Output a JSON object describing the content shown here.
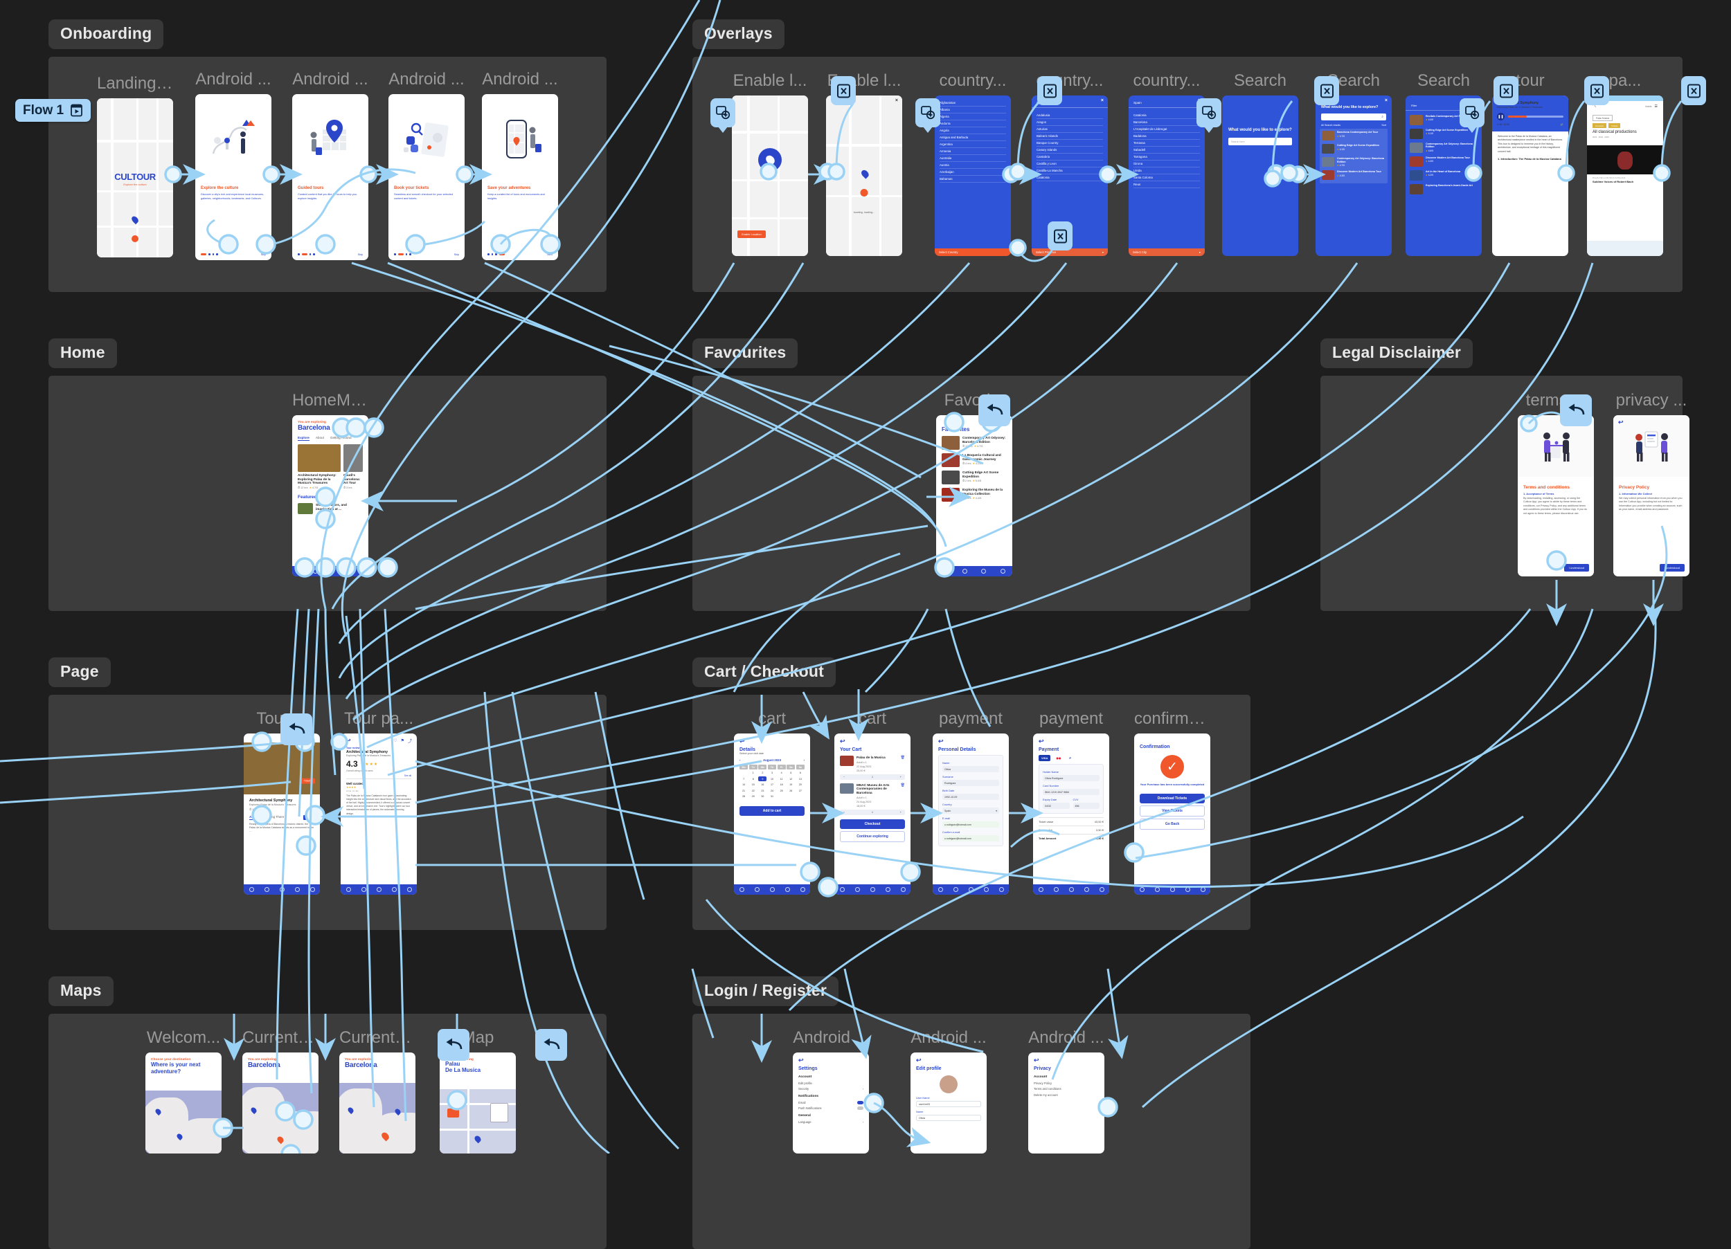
{
  "app": {
    "flow_badge_label": "Flow 1",
    "canvas_background": "#1e1e1e",
    "section_background": "#3c3c3c",
    "connector_color": "#9ad2f5",
    "badge_color": "#a8d4f7",
    "brand_blue": "#2b46c9",
    "brand_orange": "#f0572a",
    "brand_name": "CULTOUR",
    "brand_tagline": "Explore the culture"
  },
  "sections": [
    {
      "id": "onboarding",
      "label": "Onboarding",
      "frames": [
        {
          "title": "Landing ...",
          "kind": "landing"
        },
        {
          "title": "Android ...",
          "kind": "onboard",
          "heading": "Explore the culture",
          "body": "Discover a city's rich and experience local museums, galleries, neighborhoods, landmarks, and Cultours."
        },
        {
          "title": "Android ...",
          "kind": "onboard",
          "heading": "Guided tours",
          "body": "Curated content that you like for tours to help you explore insights."
        },
        {
          "title": "Android ...",
          "kind": "onboard",
          "heading": "Book your tickets",
          "body": "Seamless and smooth checkout for your selected content and tickets."
        },
        {
          "title": "Android ...",
          "kind": "onboard",
          "heading": "Save your adventures",
          "body": "Keep a curated list of tours and monuments and insights."
        }
      ]
    },
    {
      "id": "overlays",
      "label": "Overlays",
      "frames": [
        {
          "title": "Enable l...",
          "kind": "enable-location",
          "button": "Enable Location"
        },
        {
          "title": "Enable l...",
          "kind": "locating",
          "caption": "locating, loading..."
        },
        {
          "title": "country...",
          "kind": "country-list",
          "footer": "Select Country",
          "items": [
            "Afghanistan",
            "Albania",
            "Algeria",
            "Andorra",
            "Angola",
            "Antigua and Barbuda",
            "Argentina",
            "Armenia",
            "Australia",
            "Austria",
            "Azerbaijan",
            "Bahamas"
          ]
        },
        {
          "title": "country...",
          "kind": "country-list",
          "footer": "Select Province",
          "selected": "Spain",
          "items": [
            "Andalusia",
            "Aragon",
            "Asturias",
            "Balearic Islands",
            "Basque Country",
            "Canary Islands",
            "Cantabria",
            "Castilla y Leon",
            "Castilla-La Mancha",
            "Catalonia"
          ]
        },
        {
          "title": "country...",
          "kind": "country-list",
          "footer": "Select City",
          "selected": "Spain",
          "items": [
            "Catalonia",
            "Barcelona",
            "L'Hospitalet de Llobregat",
            "Badalona",
            "Terrassa",
            "Sabadell",
            "Tarragona",
            "Girona",
            "Lleida",
            "Santa Coloma",
            "Reus"
          ]
        },
        {
          "title": "Search",
          "kind": "search-empty",
          "prompt": "What would you like to explore?",
          "placeholder": "Search here"
        },
        {
          "title": "Search",
          "kind": "search-results",
          "prompt": "What would you like to explore?",
          "results_label": "All Search results",
          "sort_label": "Sort",
          "results": [
            {
              "title": "Barcelona Contemporary Art Tour",
              "rating": "4.7/5"
            },
            {
              "title": "Cutting Edge Art Scene Expedition",
              "rating": "4.1/5"
            },
            {
              "title": "Contemporary Art Odyssey: Barcelona Edition",
              "rating": "4.7/5"
            },
            {
              "title": "Discover Modern Art Barcelona Tour",
              "rating": "4.3/5"
            }
          ]
        },
        {
          "title": "Search",
          "kind": "search-list",
          "filter": "Filter",
          "results": [
            {
              "title": "Recitals Contemporary Art Park",
              "rating": "4.4/5"
            },
            {
              "title": "Cutting Edge Art Scene Expedition",
              "rating": "4.1/5"
            },
            {
              "title": "Contemporary Art Odyssey: Barcelona Edition",
              "rating": "4.6/5"
            },
            {
              "title": "Discover Modern Art Barcelona Tour",
              "rating": "4.3/5"
            },
            {
              "title": "Art in the Heart of Barcelona",
              "rating": "4.2/5"
            },
            {
              "title": "Exploring Barcelona's Avant-Garde Art",
              "rating": "4.5/5"
            }
          ]
        },
        {
          "title": "tour",
          "kind": "tour-audio",
          "heading": "Architectural Symphony",
          "subheading": "Exploring Palau de la Musica's Treasures",
          "time": "0:45 / 12:30",
          "body": "Welcome to the Palau de la Musica Catalana, an architectural masterpiece nestled in the heart of Barcelona. This tour is designed to immerse you in the history, architecture, and exceptional heritage of this magnificent concert hall.",
          "section_title": "1. Introduction: The Palau de la Musica Catalana"
        },
        {
          "title": "pa...",
          "kind": "web-page",
          "heading": "All classical productions",
          "tag": "Palau Musica"
        }
      ]
    },
    {
      "id": "home",
      "label": "Home",
      "frames": [
        {
          "title": "HomeMain",
          "kind": "home",
          "eyebrow": "You are exploring",
          "city": "Barcelona",
          "tabs": [
            "Explore",
            "About",
            "Getting Around"
          ],
          "cards": [
            {
              "title": "Architectural Symphony: Exploring Palau de la Musica's Treasures",
              "meta": "12 hrs",
              "rating": "4.7/5"
            },
            {
              "title": "Gaudi's Barcelona: Art Tour",
              "meta": "3 hrs",
              "rating": "4.5/5"
            }
          ],
          "featured_label": "Featured",
          "featured_title": "Stories, flavors, and imagination at ..."
        }
      ]
    },
    {
      "id": "favourites",
      "label": "Favourites",
      "frames": [
        {
          "title": "Favori...",
          "kind": "favourites",
          "heading": "Favourites",
          "items": [
            {
              "title": "Contemporary Art Odyssey: Barcelona Edition",
              "meta": "12 hrs",
              "rating": "4.7/5"
            },
            {
              "title": "La Boqueria Cultural and Gastronomic Journey",
              "meta": "4 hrs",
              "rating": "4.1/5"
            },
            {
              "title": "Cutting Edge Art Scene Expedition",
              "meta": "2 hrs",
              "rating": "5.0/5"
            },
            {
              "title": "Exploring the Museu de la Musica Collection",
              "meta": "3 hrs",
              "rating": "4.4/5"
            }
          ]
        }
      ]
    },
    {
      "id": "legal",
      "label": "Legal Disclaimer",
      "frames": [
        {
          "title": "terms ...",
          "kind": "legal",
          "heading": "Terms and conditions",
          "sub": "1. Acceptance of Terms",
          "body": "By downloading, installing, accessing, or using the Cultour App, you agree to abide by these terms and conditions, our Privacy Policy, and any additional terms and conditions provided within the Cultour App. If you do not agree to these terms, please discontinue use.",
          "button": "I understood"
        },
        {
          "title": "privacy ...",
          "kind": "legal",
          "heading": "Privacy Policy",
          "sub": "1. Information We Collect",
          "body": "We may collect personal information from you when you use the Cultour App, including but not limited to: Information you provide when creating an account, such as your name, email address and password.",
          "button": "I understood"
        }
      ]
    },
    {
      "id": "page",
      "label": "Page",
      "frames": [
        {
          "title": "Tour ...",
          "kind": "tour-detail",
          "badge": "Tickets",
          "heading": "Architectural Symphony",
          "subheading": "Exploring Palau de la Musica's Treasures",
          "meta": "12 hrs",
          "rating": "4.7/5",
          "tabs": [
            "About",
            "Getting There"
          ],
          "body": "Ready for an opera of Barcelona's historic district, the Palau de la Musica Catalana stands as a monument to the ..."
        },
        {
          "title": "Tour pa...",
          "kind": "tour-reviews",
          "eyebrow": "Tour reviews",
          "heading": "Architectural Symphony",
          "subheading": "Exploring Palau de la Musica's Treasures",
          "rating_value": "4.3",
          "rating_caption": "Overall rating of 396 users",
          "see_all": "See all",
          "review_title": "Well curated",
          "review_meta": "Anna, 11 Jan",
          "review_body": "The Palau de la Musica Catalana's tour gave a fascinating insight into the architecture and visual flows, and the acoustics of the hall. Highly recommended, it offered a classical concert venue, and an impressive one. Tour's highlights were our tour interactive breakdown of pieces, the automatic stunning design."
        }
      ]
    },
    {
      "id": "cart",
      "label": "Cart / Checkout",
      "frames": [
        {
          "title": "cart",
          "kind": "cart-details",
          "heading": "Details",
          "sub": "Select your visit date",
          "month": "August 2023",
          "button": "Add to cart",
          "weekdays": [
            "Mo",
            "Tu",
            "We",
            "Th",
            "Fr",
            "Sa",
            "Su"
          ],
          "selected_day": "9"
        },
        {
          "title": "cart",
          "kind": "cart-items",
          "heading": "Your Cart",
          "items": [
            {
              "title": "Palau de la Musica",
              "sub": "Adult x 1",
              "price": "25,00 €",
              "date": "22 Aug 2023"
            },
            {
              "title": "MNAC Museu de Arts Contemporanies de Barcelona",
              "sub": "Adult x 1",
              "price": "18,00 €",
              "date": "24 Aug 2023"
            }
          ],
          "primary": "Checkout",
          "secondary": "Continue exploring"
        },
        {
          "title": "payment",
          "kind": "personal-details",
          "heading": "Personal Details",
          "fields": [
            {
              "label": "Name",
              "value": "Olivia"
            },
            {
              "label": "Surname",
              "value": "Rodriguez"
            },
            {
              "label": "Birth Date",
              "value": "1992-10-09"
            },
            {
              "label": "Country",
              "value": "Spain"
            },
            {
              "label": "E-mail",
              "value": "o.rodriguez@hotmail.com"
            },
            {
              "label": "Confirm e-mail",
              "value": "o.rodriguez@hotmail.com"
            }
          ]
        },
        {
          "title": "payment",
          "kind": "payment",
          "heading": "Payment",
          "methods": [
            "VISA",
            "Mastercard",
            "PayPal"
          ],
          "fields": [
            {
              "label": "Holder Name",
              "value": "Olivia Rodriguez"
            },
            {
              "label": "Card Number",
              "value": "5641 1219 4947 9684"
            },
            {
              "label": "Expiry Date",
              "value": "04/32"
            },
            {
              "label": "CVV",
              "value": "456"
            }
          ],
          "summary": [
            {
              "label": "Ticket value",
              "value": "43,00 €"
            },
            {
              "label": "Service fee",
              "value": "3,50 €"
            },
            {
              "label": "Total Amount",
              "value": "46,50 €"
            }
          ]
        },
        {
          "title": "confirma...",
          "kind": "confirmation",
          "heading": "Confirmation",
          "message": "Your Purchase has been successfully completed",
          "primary": "Download Tickets",
          "secondary": "View Tickets",
          "tertiary": "Go Back"
        }
      ]
    },
    {
      "id": "maps",
      "label": "Maps",
      "frames": [
        {
          "title": "Welcom...",
          "kind": "map-welcome",
          "eyebrow": "Choose your destination",
          "heading": "Where is your next adventure?"
        },
        {
          "title": "Current l...",
          "kind": "map-city",
          "eyebrow": "You are exploring",
          "city": "Barcelona"
        },
        {
          "title": "Current l...",
          "kind": "map-city-pin",
          "eyebrow": "You are exploring",
          "city": "Barcelona"
        },
        {
          "title": "Map",
          "kind": "map-detail",
          "eyebrow": "You are exploring",
          "title_l1": "Palau",
          "title_l2": "De La Musica"
        }
      ]
    },
    {
      "id": "login",
      "label": "Login / Register",
      "frames": [
        {
          "title": "Android ...",
          "kind": "settings",
          "heading": "Settings",
          "groups": [
            {
              "group": "Account",
              "items": [
                "Edit profile",
                "Security"
              ]
            },
            {
              "group": "Notifications",
              "items": [
                "Email",
                "Push Notifications"
              ]
            },
            {
              "group": "General",
              "items": [
                "Language"
              ]
            }
          ]
        },
        {
          "title": "Android ...",
          "kind": "edit-profile",
          "heading": "Edit profile",
          "fields": [
            {
              "label": "User Name",
              "value": "user1m03"
            },
            {
              "label": "Name",
              "value": "Olivia"
            }
          ]
        },
        {
          "title": "Android ...",
          "kind": "privacy-settings",
          "heading": "Privacy",
          "groups": [
            {
              "group": "Account",
              "items": [
                "Privacy Policy",
                "Terms and conditions",
                "Delete my account"
              ]
            }
          ]
        }
      ]
    }
  ],
  "icons": {
    "flow_play": "play-in-frame-icon",
    "open_overlay": "open-overlay-icon",
    "close_overlay": "close-overlay-icon",
    "back_navigate": "back-arrow-icon"
  }
}
